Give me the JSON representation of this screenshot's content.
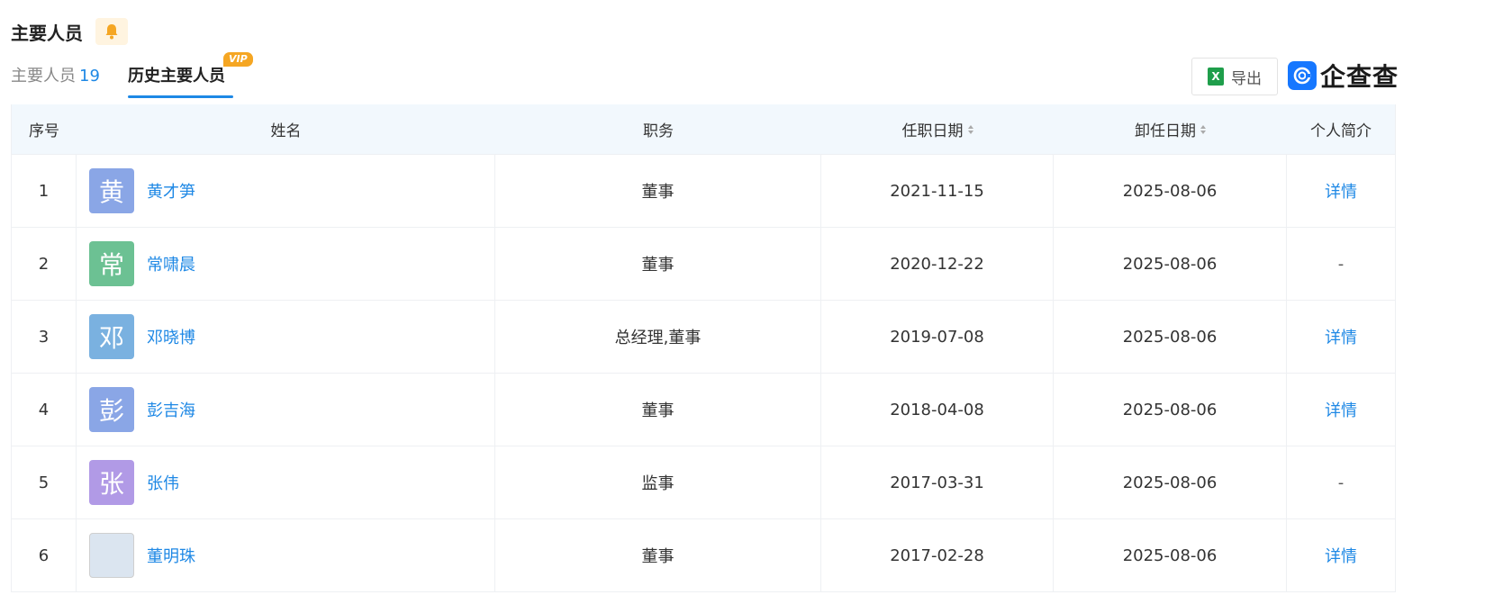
{
  "section": {
    "title": "主要人员"
  },
  "tabs": {
    "people_label": "主要人员",
    "people_count": "19",
    "history_label": "历史主要人员",
    "vip_badge": "VIP"
  },
  "toolbar": {
    "export_label": "导出",
    "excel_icon_text": "X",
    "brand_text": "企查查"
  },
  "colors": {
    "accent": "#1e88e5",
    "header_bg": "#f2f8fd",
    "vip": "#f5a623"
  },
  "table": {
    "headers": {
      "index": "序号",
      "name": "姓名",
      "position": "职务",
      "start_date": "任职日期",
      "end_date": "卸任日期",
      "bio": "个人简介"
    },
    "rows": [
      {
        "index": "1",
        "avatar_char": "黄",
        "avatar_color": "#8aa6e6",
        "name": "黄才笋",
        "position": "董事",
        "start_date": "2021-11-15",
        "end_date": "2025-08-06",
        "bio": "详情"
      },
      {
        "index": "2",
        "avatar_char": "常",
        "avatar_color": "#6cc193",
        "name": "常啸晨",
        "position": "董事",
        "start_date": "2020-12-22",
        "end_date": "2025-08-06",
        "bio": "-"
      },
      {
        "index": "3",
        "avatar_char": "邓",
        "avatar_color": "#7ab1e0",
        "name": "邓晓博",
        "position": "总经理,董事",
        "start_date": "2019-07-08",
        "end_date": "2025-08-06",
        "bio": "详情"
      },
      {
        "index": "4",
        "avatar_char": "彭",
        "avatar_color": "#8aa6e6",
        "name": "彭吉海",
        "position": "董事",
        "start_date": "2018-04-08",
        "end_date": "2025-08-06",
        "bio": "详情"
      },
      {
        "index": "5",
        "avatar_char": "张",
        "avatar_color": "#b19ae6",
        "name": "张伟",
        "position": "监事",
        "start_date": "2017-03-31",
        "end_date": "2025-08-06",
        "bio": "-"
      },
      {
        "index": "6",
        "avatar_char": "",
        "avatar_color": "",
        "name": "董明珠",
        "position": "董事",
        "start_date": "2017-02-28",
        "end_date": "2025-08-06",
        "bio": "详情"
      }
    ]
  }
}
